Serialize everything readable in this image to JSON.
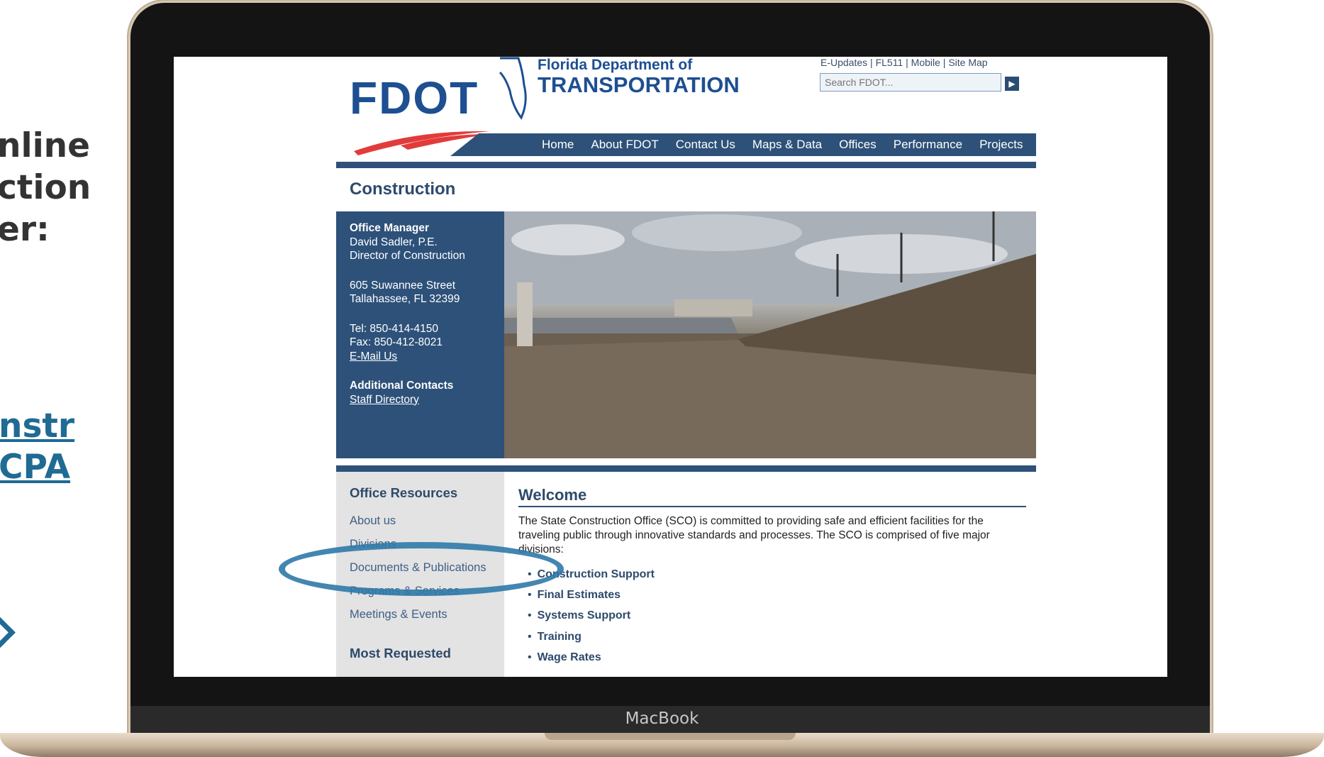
{
  "slide": {
    "heading_lines": "nline\nction\ner:",
    "link_lines": "nstr\nCPA"
  },
  "device": {
    "label": "MacBook"
  },
  "site": {
    "logo_text": "FDOT",
    "brand_line1": "Florida Department of",
    "brand_line2": "TRANSPORTATION",
    "util_links": [
      "E-Updates",
      "FL511",
      "Mobile",
      "Site Map"
    ],
    "search_placeholder": "Search FDOT...",
    "nav": [
      "Home",
      "About FDOT",
      "Contact Us",
      "Maps & Data",
      "Offices",
      "Performance",
      "Projects"
    ],
    "page_title": "Construction"
  },
  "office": {
    "manager_heading": "Office Manager",
    "manager_name": "David Sadler, P.E.",
    "manager_title": "Director of Construction",
    "address_line1": "605 Suwannee Street",
    "address_line2": "Tallahassee, FL 32399",
    "tel": "Tel: 850-414-4150",
    "fax": "Fax: 850-412-8021",
    "email_link": "E-Mail Us",
    "contacts_heading": "Additional Contacts",
    "staff_link": "Staff Directory"
  },
  "sidebar": {
    "resources_heading": "Office Resources",
    "links": [
      "About us",
      "Divisions",
      "Documents & Publications",
      "Programs & Services",
      "Meetings & Events"
    ],
    "most_requested_heading": "Most Requested"
  },
  "welcome": {
    "title": "Welcome",
    "body": "The State Construction Office (SCO) is committed to providing safe and efficient facilities for the traveling public through innovative standards and processes. The SCO is comprised of five major divisions:",
    "divisions": [
      "Construction Support",
      "Final Estimates",
      "Systems Support",
      "Training",
      "Wage Rates"
    ]
  },
  "colors": {
    "brand_blue": "#1d4f91",
    "nav_blue": "#2d5179",
    "highlight_ring": "#2f79a8",
    "slide_link": "#1f6b94"
  }
}
